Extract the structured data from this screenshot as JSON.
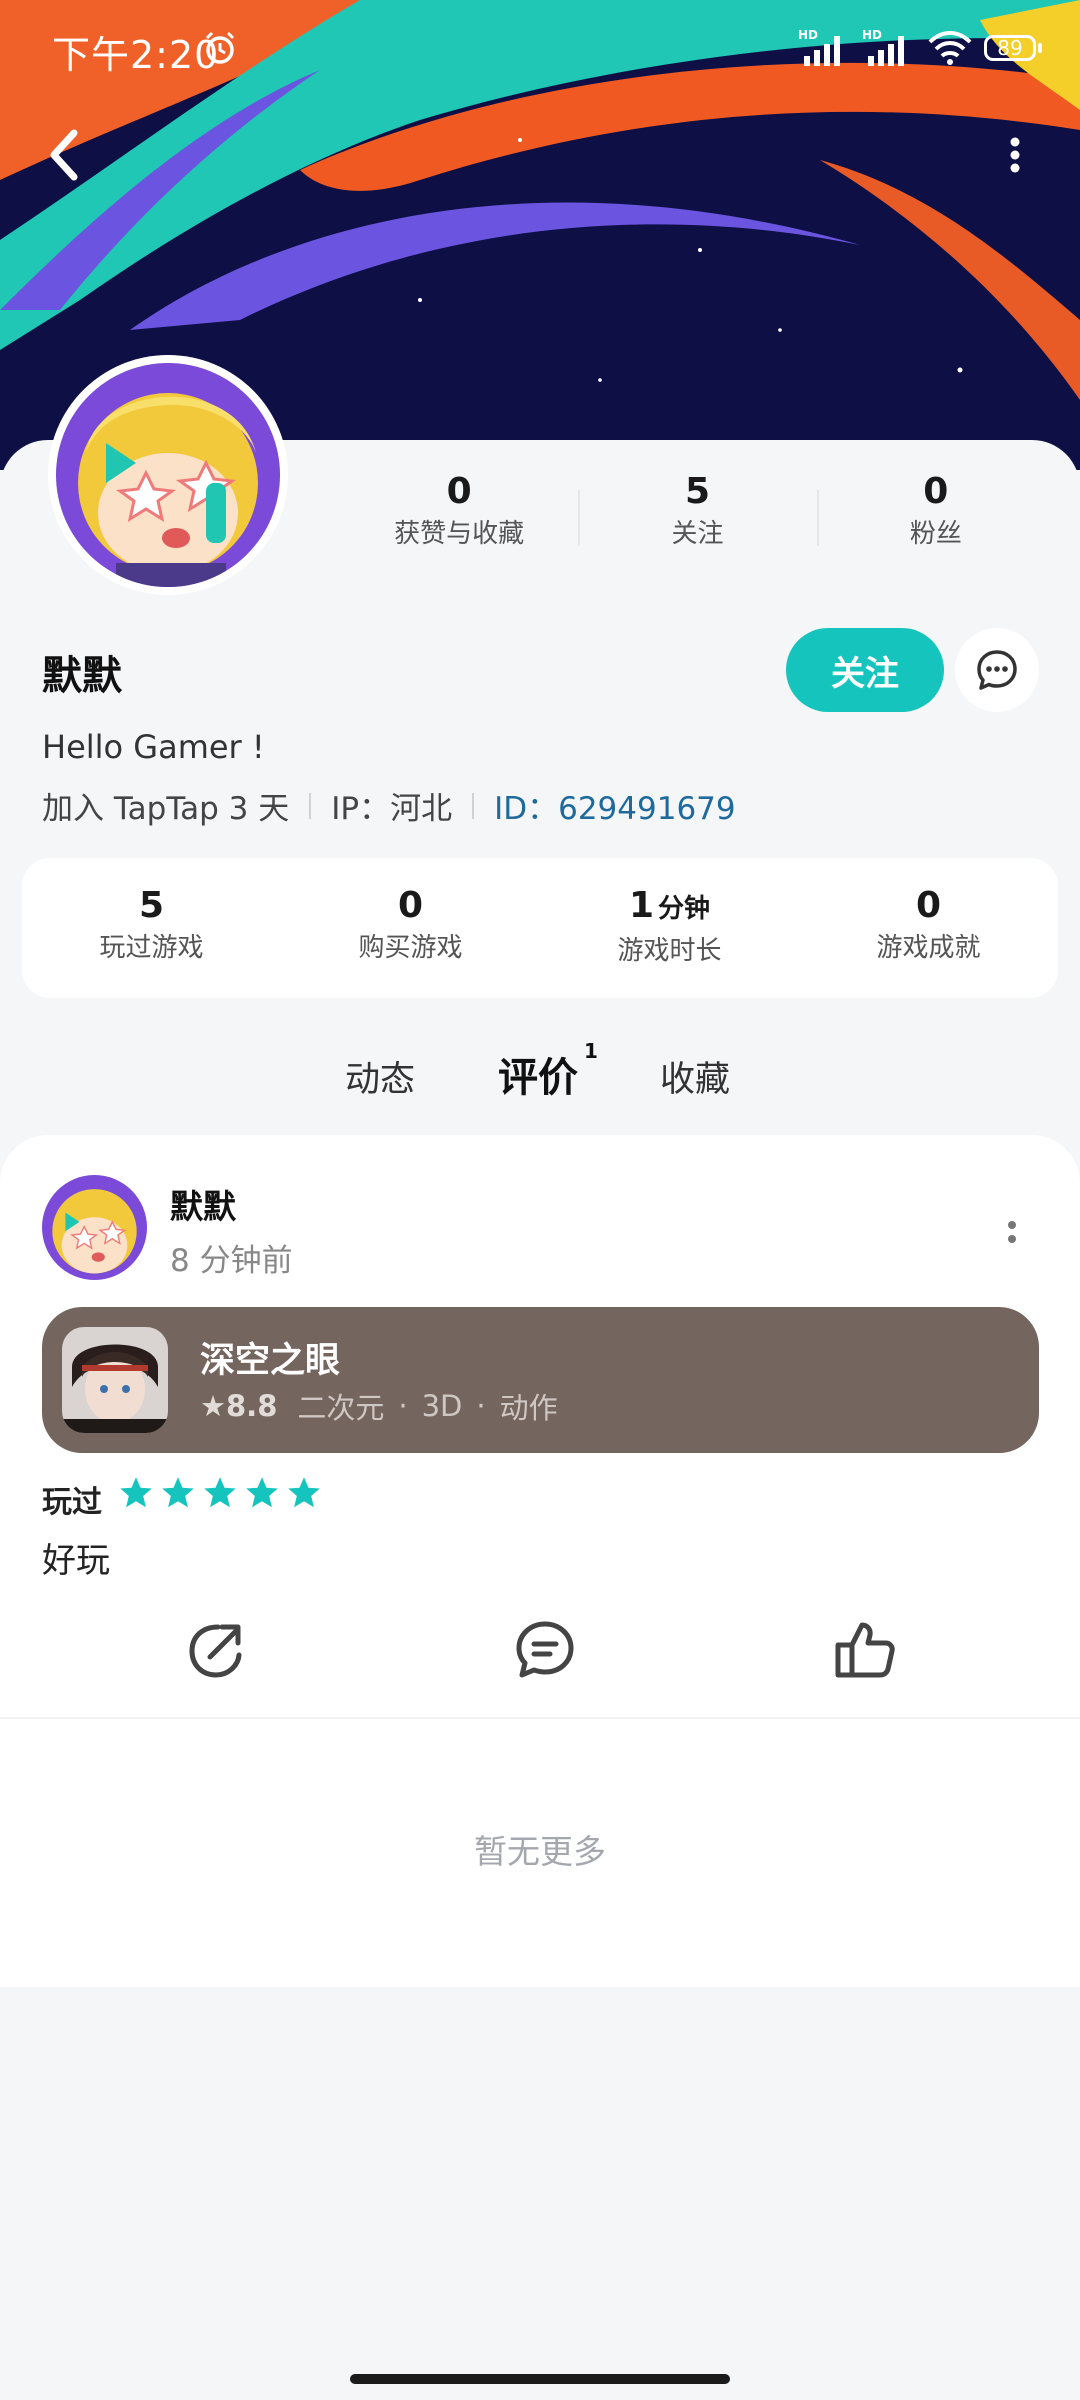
{
  "status_bar": {
    "time": "下午2:20",
    "network_badge_1": "HD",
    "network_badge_2": "HD",
    "battery": "89",
    "icons": [
      "alarm-icon",
      "signal-icon",
      "wifi-icon",
      "battery-icon"
    ]
  },
  "header": {
    "back_icon": "chevron-left-icon",
    "more_icon": "vertical-dots-icon"
  },
  "profile": {
    "username": "默默",
    "bio": "Hello Gamer !",
    "joined": "加入 TapTap 3 天",
    "ip": "IP：河北",
    "id": "ID：629491679",
    "follow_label": "关注",
    "message_icon": "chat-bubble-icon",
    "social_stats": [
      {
        "value": "0",
        "label": "获赞与收藏"
      },
      {
        "value": "5",
        "label": "关注"
      },
      {
        "value": "0",
        "label": "粉丝"
      }
    ],
    "game_stats": [
      {
        "value": "5",
        "unit": "",
        "label": "玩过游戏"
      },
      {
        "value": "0",
        "unit": "",
        "label": "购买游戏"
      },
      {
        "value": "1",
        "unit": "分钟",
        "label": "游戏时长"
      },
      {
        "value": "0",
        "unit": "",
        "label": "游戏成就"
      }
    ]
  },
  "tabs": [
    {
      "label": "动态",
      "active": false
    },
    {
      "label": "评价",
      "active": true,
      "badge": "1"
    },
    {
      "label": "收藏",
      "active": false
    }
  ],
  "post": {
    "author": "默默",
    "time": "8 分钟前",
    "game": {
      "title": "深空之眼",
      "score": "8.8",
      "tags": [
        "二次元",
        "3D",
        "动作"
      ]
    },
    "played_label": "玩过",
    "rating": 5,
    "text": "好玩",
    "actions": [
      "share-icon",
      "comment-icon",
      "like-icon"
    ]
  },
  "feed_end": "暂无更多",
  "colors": {
    "accent": "#15c5bd",
    "banner_bg": "#0e0f45",
    "game_card": "#75655f",
    "id_link": "#1f6a9b"
  }
}
